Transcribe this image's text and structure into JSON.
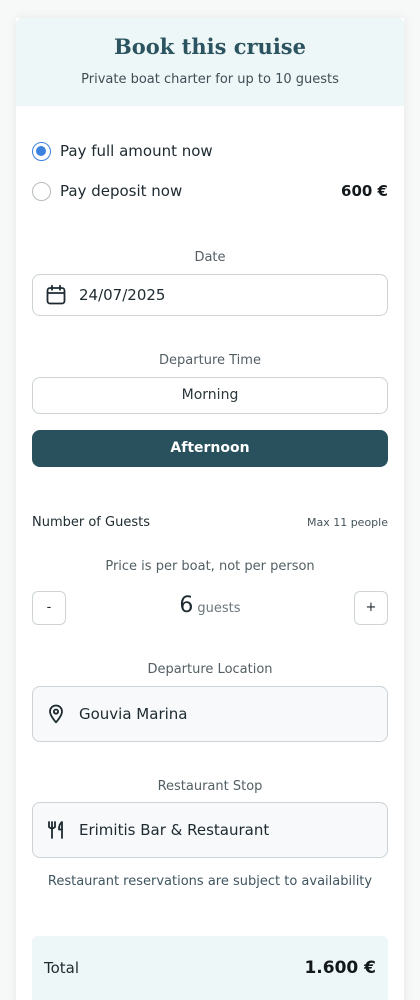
{
  "header": {
    "title": "Book this cruise",
    "subtitle": "Private boat charter for up to 10 guests"
  },
  "payment": {
    "options": [
      {
        "label": "Pay full amount now",
        "selected": true
      },
      {
        "label": "Pay deposit now",
        "amount": "600 €",
        "selected": false
      }
    ]
  },
  "date": {
    "label": "Date",
    "value": "24/07/2025",
    "icon": "calendar-icon"
  },
  "departure_time": {
    "label": "Departure Time",
    "options": [
      {
        "label": "Morning",
        "active": false
      },
      {
        "label": "Afternoon",
        "active": true
      }
    ]
  },
  "guests": {
    "label": "Number of Guests",
    "max": "Max 11 people",
    "price_note": "Price is per boat, not per person",
    "decrement_label": "-",
    "increment_label": "+",
    "count": "6",
    "unit": "guests"
  },
  "departure_location": {
    "label": "Departure Location",
    "value": "Gouvia Marina",
    "icon": "map-pin-icon"
  },
  "restaurant": {
    "label": "Restaurant Stop",
    "value": "Erimitis Bar & Restaurant",
    "icon": "fork-knife-icon",
    "note": "Restaurant reservations are subject to availability"
  },
  "total": {
    "label": "Total",
    "value": "1.600 €"
  },
  "colors": {
    "accent": "#28505d",
    "header_bg": "#eef7f8",
    "radio_selected": "#3b82e0"
  }
}
